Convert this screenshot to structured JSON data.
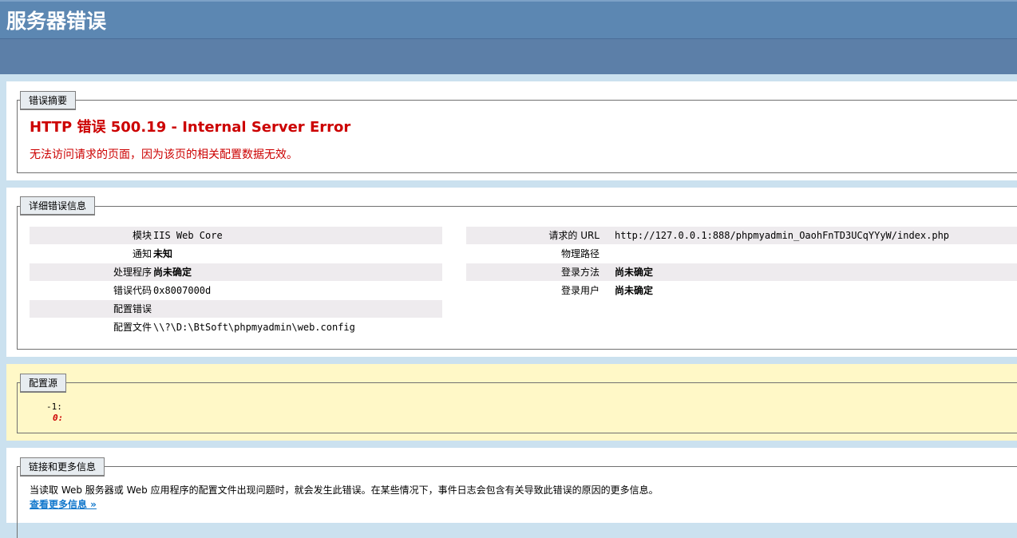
{
  "header": {
    "title": "服务器错误"
  },
  "summary": {
    "legend": "错误摘要",
    "title": "HTTP 错误 500.19 - Internal Server Error",
    "message": "无法访问请求的页面，因为该页的相关配置数据无效。"
  },
  "details": {
    "legend": "详细错误信息",
    "left": [
      {
        "key": "模块",
        "value": "IIS Web Core",
        "cn": false
      },
      {
        "key": "通知",
        "value": "未知",
        "cn": true
      },
      {
        "key": "处理程序",
        "value": "尚未确定",
        "cn": true
      },
      {
        "key": "错误代码",
        "value": "0x8007000d",
        "cn": false
      },
      {
        "key": "配置错误",
        "value": "",
        "cn": false
      },
      {
        "key": "配置文件",
        "value": "\\\\?\\D:\\BtSoft\\phpmyadmin\\web.config",
        "cn": false
      }
    ],
    "right": [
      {
        "key": "请求的 URL",
        "value": "http://127.0.0.1:888/phpmyadmin_OaohFnTD3UCqYYyW/index.php",
        "cn": false
      },
      {
        "key": "物理路径",
        "value": "",
        "cn": false
      },
      {
        "key": "登录方法",
        "value": "尚未确定",
        "cn": true
      },
      {
        "key": "登录用户",
        "value": "尚未确定",
        "cn": true
      }
    ]
  },
  "config_source": {
    "legend": "配置源",
    "line1": "-1:",
    "line2": "0:"
  },
  "more_info": {
    "legend": "链接和更多信息",
    "text": "当读取 Web 服务器或 Web 应用程序的配置文件出现问题时，就会发生此错误。在某些情况下，事件日志会包含有关导致此错误的原因的更多信息。",
    "link": "查看更多信息 »"
  },
  "colors": {
    "header": "#5C87B2",
    "error_red": "#CC0000",
    "link_blue": "#1177CC",
    "config_bg": "#FFF8C7",
    "shaded_row": "#EEEBEE"
  }
}
